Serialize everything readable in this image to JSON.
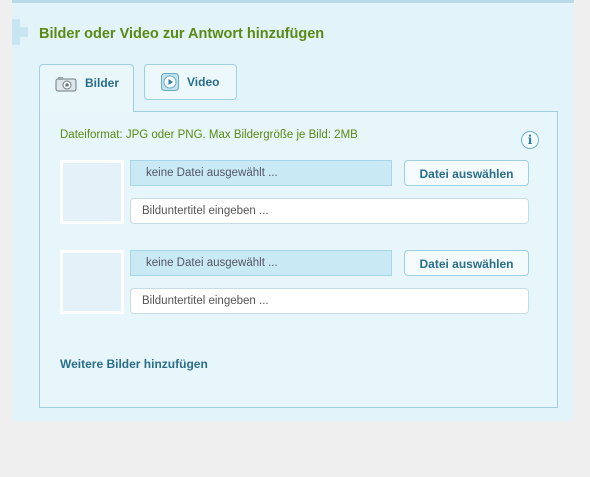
{
  "section": {
    "heading": "Bilder oder Video zur Antwort hinzufügen"
  },
  "tabs": [
    {
      "label": "Bilder",
      "icon": "camera-icon",
      "active": true
    },
    {
      "label": "Video",
      "icon": "play-icon",
      "active": false
    }
  ],
  "upload": {
    "format_note": "Dateiformat: JPG oder PNG. Max Bildergröße je Bild: 2MB",
    "info_icon": "info-icon",
    "rows": [
      {
        "file_status": "keine Datei ausgewählt ...",
        "choose_label": "Datei auswählen",
        "caption_placeholder": "Bilduntertitel eingeben ..."
      },
      {
        "file_status": "keine Datei ausgewählt ...",
        "choose_label": "Datei auswählen",
        "caption_placeholder": "Bilduntertitel eingeben ..."
      }
    ],
    "more_link": "Weitere Bilder hinzufügen"
  },
  "colors": {
    "heading_green": "#5a8a12",
    "link_blue": "#2a6e8c",
    "panel_bg": "#e2f3fa"
  }
}
